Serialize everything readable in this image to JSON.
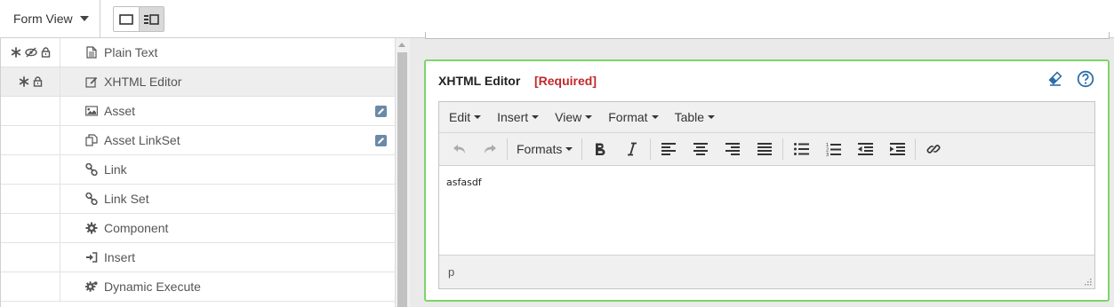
{
  "topbar": {
    "form_view_label": "Form View",
    "view_toggle": [
      "single-panel-view",
      "split-panel-view"
    ]
  },
  "fields": [
    {
      "label": "Plain Text",
      "icon": "document-icon",
      "flags": [
        "asterisk-icon",
        "eye-slash-icon",
        "lock-icon"
      ],
      "selected": false,
      "edit": false
    },
    {
      "label": "XHTML Editor",
      "icon": "edit-document-icon",
      "flags": [
        "asterisk-icon",
        "lock-icon"
      ],
      "selected": true,
      "edit": false
    },
    {
      "label": "Asset",
      "icon": "image-icon",
      "flags": [],
      "selected": false,
      "edit": true
    },
    {
      "label": "Asset LinkSet",
      "icon": "copy-icon",
      "flags": [],
      "selected": false,
      "edit": true
    },
    {
      "label": "Link",
      "icon": "chain-link-icon",
      "flags": [],
      "selected": false,
      "edit": false
    },
    {
      "label": "Link Set",
      "icon": "chain-link-icon",
      "flags": [],
      "selected": false,
      "edit": false
    },
    {
      "label": "Component",
      "icon": "gear-icon",
      "flags": [],
      "selected": false,
      "edit": false
    },
    {
      "label": "Insert",
      "icon": "sign-in-icon",
      "flags": [],
      "selected": false,
      "edit": false
    },
    {
      "label": "Dynamic Execute",
      "icon": "gears-icon",
      "flags": [],
      "selected": false,
      "edit": false
    }
  ],
  "panel": {
    "title": "XHTML Editor",
    "required": "[Required]",
    "accent_color": "#7dd56a",
    "required_color": "#c0282d"
  },
  "editor": {
    "menus": [
      "Edit",
      "Insert",
      "View",
      "Format",
      "Table"
    ],
    "formats_label": "Formats",
    "content": "asfasdf",
    "status_path": "p"
  }
}
